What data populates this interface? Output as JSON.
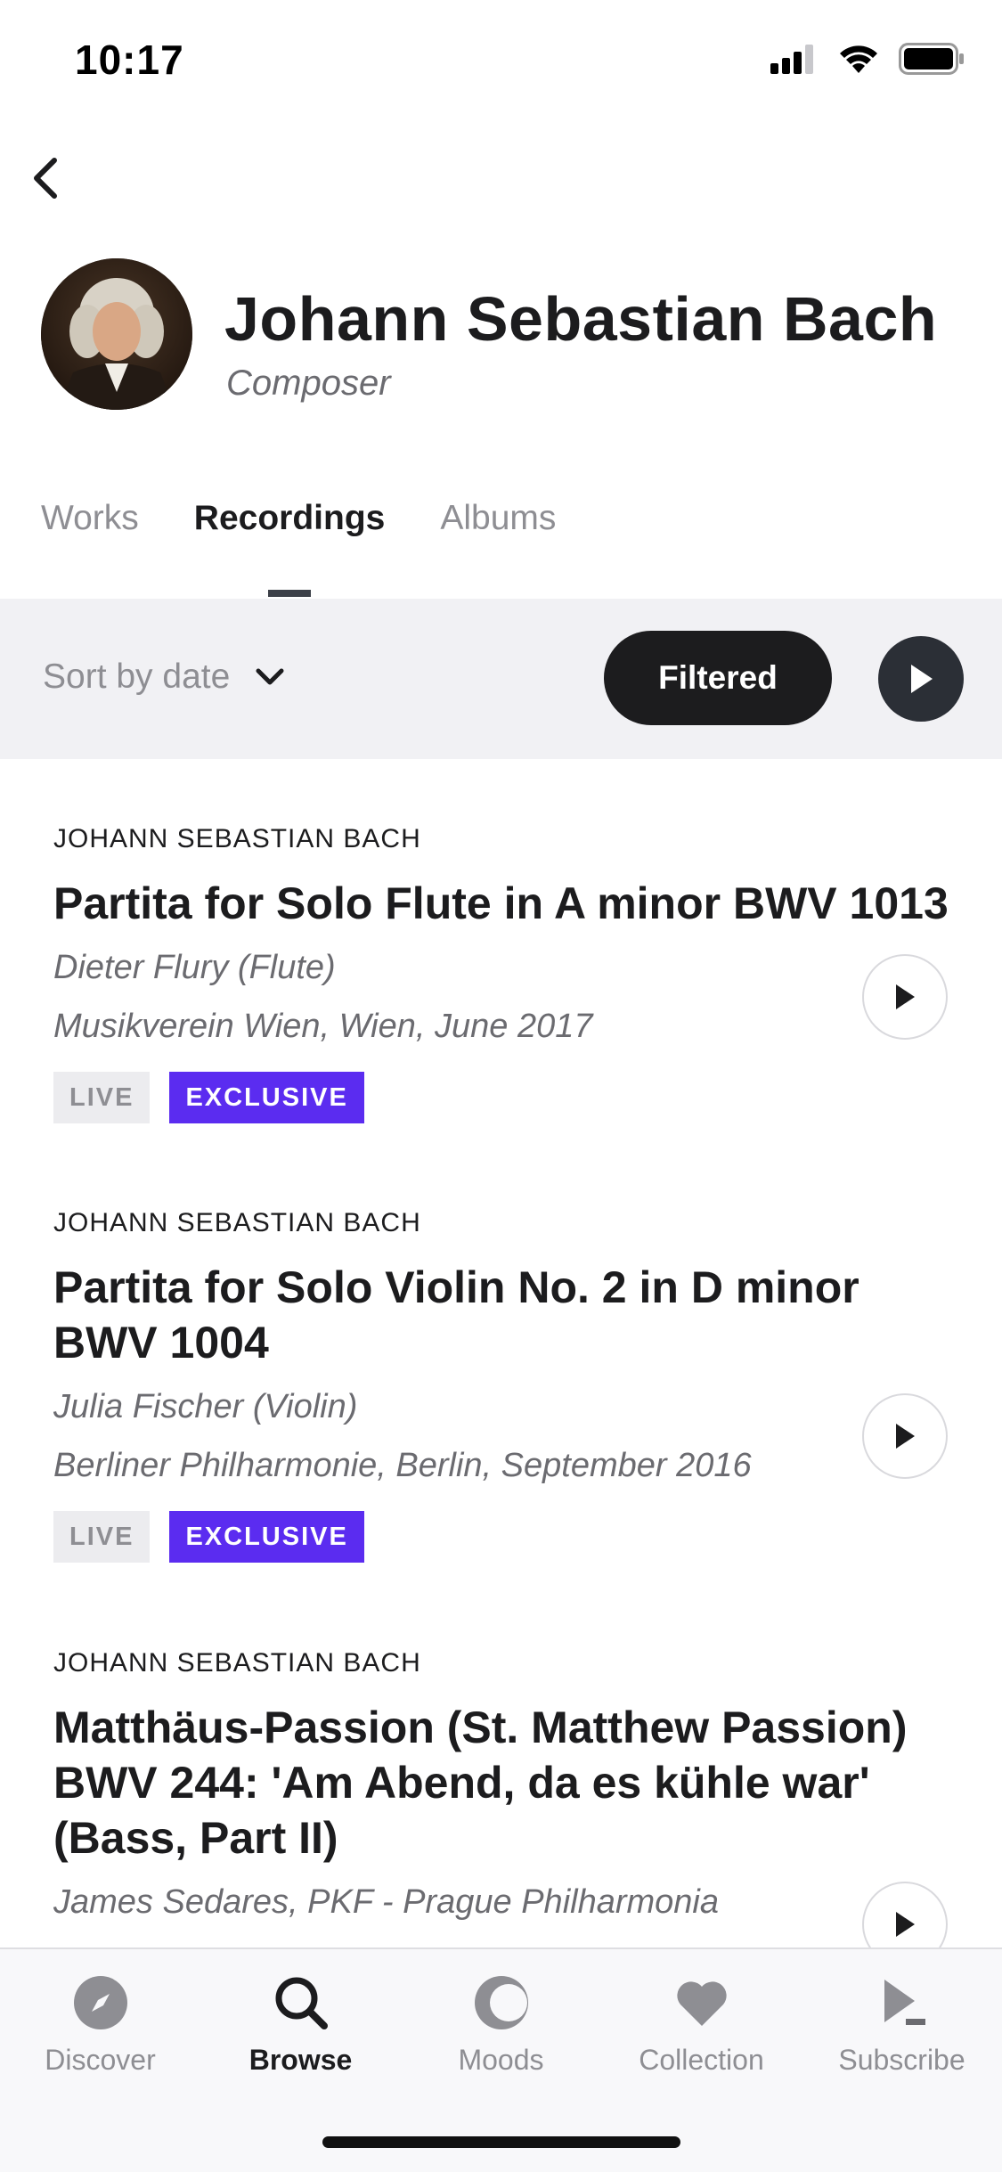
{
  "status": {
    "time": "10:17"
  },
  "artist": {
    "name": "Johann Sebastian Bach",
    "role": "Composer"
  },
  "tabs": [
    {
      "label": "Works",
      "active": false
    },
    {
      "label": "Recordings",
      "active": true
    },
    {
      "label": "Albums",
      "active": false
    }
  ],
  "sort": {
    "label": "Sort by date",
    "filter_label": "Filtered"
  },
  "recordings": [
    {
      "composer": "JOHANN SEBASTIAN BACH",
      "title": "Partita for Solo Flute in A minor BWV 1013",
      "performer": "Dieter Flury (Flute)",
      "venue": "Musikverein Wien, Wien, June 2017",
      "badges": [
        "LIVE",
        "EXCLUSIVE"
      ]
    },
    {
      "composer": "JOHANN SEBASTIAN BACH",
      "title": "Partita for Solo Violin No. 2 in D minor BWV 1004",
      "performer": "Julia Fischer (Violin)",
      "venue": "Berliner Philharmonie, Berlin, September 2016",
      "badges": [
        "LIVE",
        "EXCLUSIVE"
      ]
    },
    {
      "composer": "JOHANN SEBASTIAN BACH",
      "title": "Matthäus-Passion (St. Matthew Passion) BWV 244:  'Am Abend, da es kühle war' (Bass, Part II)",
      "performer": "James Sedares, PKF - Prague Philharmonia",
      "venue": "",
      "badges": []
    }
  ],
  "tabbar": [
    {
      "label": "Discover",
      "icon": "compass-icon",
      "active": false
    },
    {
      "label": "Browse",
      "icon": "search-icon",
      "active": true
    },
    {
      "label": "Moods",
      "icon": "moon-icon",
      "active": false
    },
    {
      "label": "Collection",
      "icon": "heart-icon",
      "active": false
    },
    {
      "label": "Subscribe",
      "icon": "play-subscribe-icon",
      "active": false
    }
  ],
  "colors": {
    "accent": "#5b2cf0",
    "dark": "#1c1c1e",
    "muted": "#8e8e93"
  }
}
